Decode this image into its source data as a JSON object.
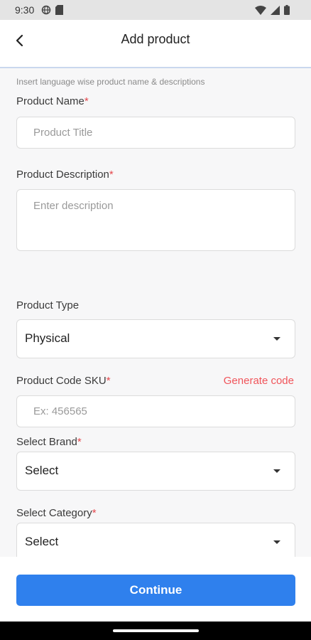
{
  "status_bar": {
    "time": "9:30"
  },
  "header": {
    "title": "Add product"
  },
  "form": {
    "hint": "Insert language wise product name & descriptions",
    "product_name": {
      "label": "Product Name",
      "required_mark": "*",
      "placeholder": "Product Title"
    },
    "product_description": {
      "label": "Product Description",
      "required_mark": "*",
      "placeholder": "Enter description"
    },
    "product_type": {
      "label": "Product Type",
      "value": "Physical"
    },
    "product_code": {
      "label": "Product Code SKU",
      "required_mark": "*",
      "placeholder": "Ex: 456565",
      "generate_label": "Generate code"
    },
    "brand": {
      "label": "Select Brand",
      "required_mark": "*",
      "value": "Select"
    },
    "category": {
      "label": "Select Category",
      "required_mark": "*",
      "value": "Select"
    }
  },
  "footer": {
    "continue_label": "Continue"
  },
  "colors": {
    "accent": "#2f80ed",
    "required": "#e5484d",
    "link": "#f0545a"
  }
}
